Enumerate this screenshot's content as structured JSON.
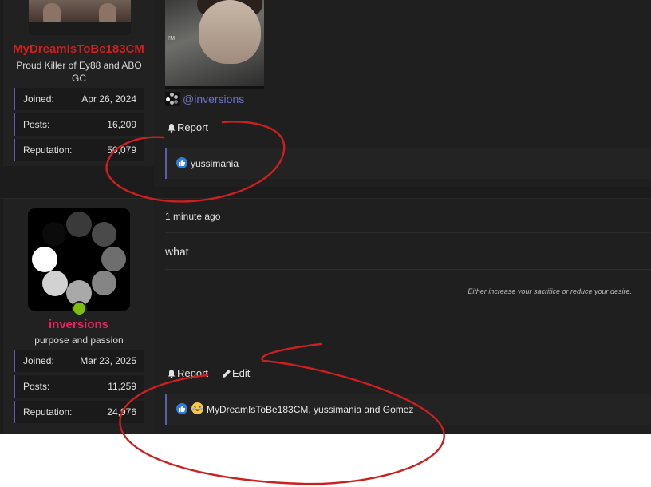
{
  "posts": [
    {
      "user": {
        "name": "MyDreamIsToBe183CM",
        "title": "Proud Killer of Ey88 and ABO GC",
        "name_color": "#d01f1f",
        "stats": [
          {
            "label": "Joined:",
            "value": "Apr 26, 2024"
          },
          {
            "label": "Posts:",
            "value": "16,209"
          },
          {
            "label": "Reputation:",
            "value": "50,079"
          }
        ]
      },
      "mention": "@inversions",
      "actions": {
        "report": "Report"
      },
      "reactions": {
        "text": "yussimania"
      }
    },
    {
      "user": {
        "name": "inversions",
        "title": "purpose and passion",
        "name_color": "#e8245e",
        "online_color": "#7bbf0c",
        "stats": [
          {
            "label": "Joined:",
            "value": "Mar 23, 2025"
          },
          {
            "label": "Posts:",
            "value": "11,259"
          },
          {
            "label": "Reputation:",
            "value": "24,976"
          }
        ]
      },
      "time": "1 minute ago",
      "message": "what",
      "signature": "Either increase your sacrifice or reduce your desire.",
      "actions": {
        "report": "Report",
        "edit": "Edit"
      },
      "reactions": {
        "text": "MyDreamIsToBe183CM, yussimania and Gomez"
      }
    }
  ],
  "colors": {
    "accent": "#5c5fa8",
    "annotation": "#cc1f1f",
    "like": "#2f7de1"
  }
}
